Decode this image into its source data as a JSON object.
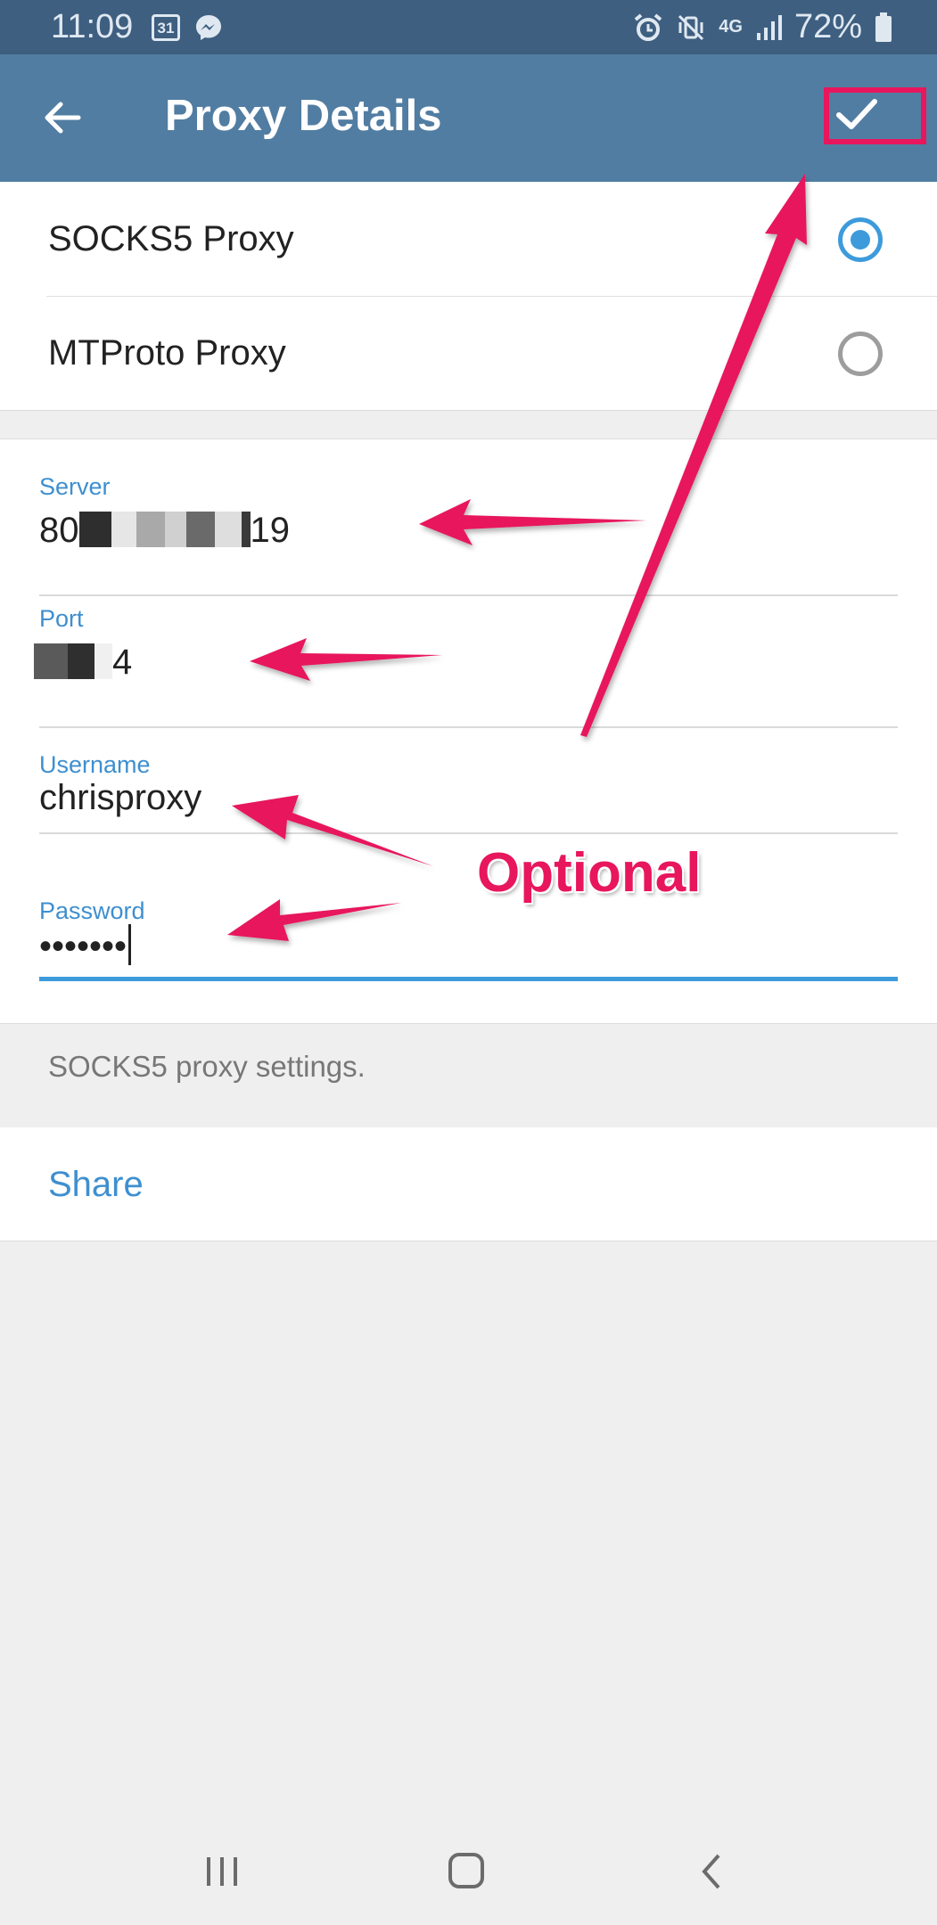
{
  "status_bar": {
    "time": "11:09",
    "calendar_day": "31",
    "network": "4G",
    "battery": "72%"
  },
  "app_bar": {
    "title": "Proxy Details"
  },
  "proxy_types": [
    {
      "label": "SOCKS5 Proxy",
      "selected": true
    },
    {
      "label": "MTProto Proxy",
      "selected": false
    }
  ],
  "fields": {
    "server": {
      "label": "Server",
      "value_start": "80",
      "value_end": "19"
    },
    "port": {
      "label": "Port",
      "value_end": "4"
    },
    "username": {
      "label": "Username",
      "value": "chrisproxy"
    },
    "password": {
      "label": "Password",
      "value": "•••••••"
    }
  },
  "hint": "SOCKS5 proxy settings.",
  "share_label": "Share",
  "annotation": {
    "text": "Optional",
    "color": "#e8175d"
  },
  "colors": {
    "app_bar": "#527da3",
    "status_bar": "#3f5f80",
    "accent": "#3e9bdb"
  }
}
